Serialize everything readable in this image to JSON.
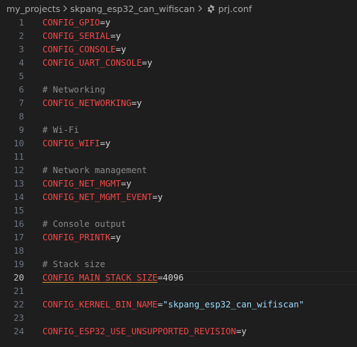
{
  "breadcrumb": {
    "items": [
      "my_projects",
      "skpang_esp32_can_wifiscan",
      "prj.conf"
    ],
    "file_icon": "gear-icon",
    "separator_icon": "chevron-right-icon"
  },
  "editor": {
    "active_line": 20,
    "lines": [
      {
        "num": "1",
        "key": "CONFIG_GPIO",
        "eq": "=",
        "value": "y"
      },
      {
        "num": "2",
        "key": "CONFIG_SERIAL",
        "eq": "=",
        "value": "y"
      },
      {
        "num": "3",
        "key": "CONFIG_CONSOLE",
        "eq": "=",
        "value": "y"
      },
      {
        "num": "4",
        "key": "CONFIG_UART_CONSOLE",
        "eq": "=",
        "value": "y"
      },
      {
        "num": "5"
      },
      {
        "num": "6",
        "comment": "# Networking"
      },
      {
        "num": "7",
        "key": "CONFIG_NETWORKING",
        "eq": "=",
        "value": "y"
      },
      {
        "num": "8"
      },
      {
        "num": "9",
        "comment": "# Wi-Fi"
      },
      {
        "num": "10",
        "key": "CONFIG_WIFI",
        "eq": "=",
        "value": "y"
      },
      {
        "num": "11"
      },
      {
        "num": "12",
        "comment": "# Network management"
      },
      {
        "num": "13",
        "key": "CONFIG_NET_MGMT",
        "eq": "=",
        "value": "y"
      },
      {
        "num": "14",
        "key": "CONFIG_NET_MGMT_EVENT",
        "eq": "=",
        "value": "y"
      },
      {
        "num": "15"
      },
      {
        "num": "16",
        "comment": "# Console output"
      },
      {
        "num": "17",
        "key": "CONFIG_PRINTK",
        "eq": "=",
        "value": "y"
      },
      {
        "num": "18"
      },
      {
        "num": "19",
        "comment": "# Stack size"
      },
      {
        "num": "20",
        "key": "CONFIG_MAIN_STACK_SIZE",
        "eq": "=",
        "value": "4096"
      },
      {
        "num": "21"
      },
      {
        "num": "22",
        "key": "CONFIG_KERNEL_BIN_NAME",
        "eq": "=",
        "string": "\"skpang_esp32_can_wifiscan\""
      },
      {
        "num": "23"
      },
      {
        "num": "24",
        "key": "CONFIG_ESP32_USE_UNSUPPORTED_REVISION",
        "eq": "=",
        "value": "y"
      }
    ]
  },
  "colors": {
    "background": "#1e1e1e",
    "key": "#f44747",
    "comment": "#8a8a8a",
    "string": "#9cdcfe",
    "line_number": "#6e7681",
    "active_line_number": "#c6c6c6"
  }
}
